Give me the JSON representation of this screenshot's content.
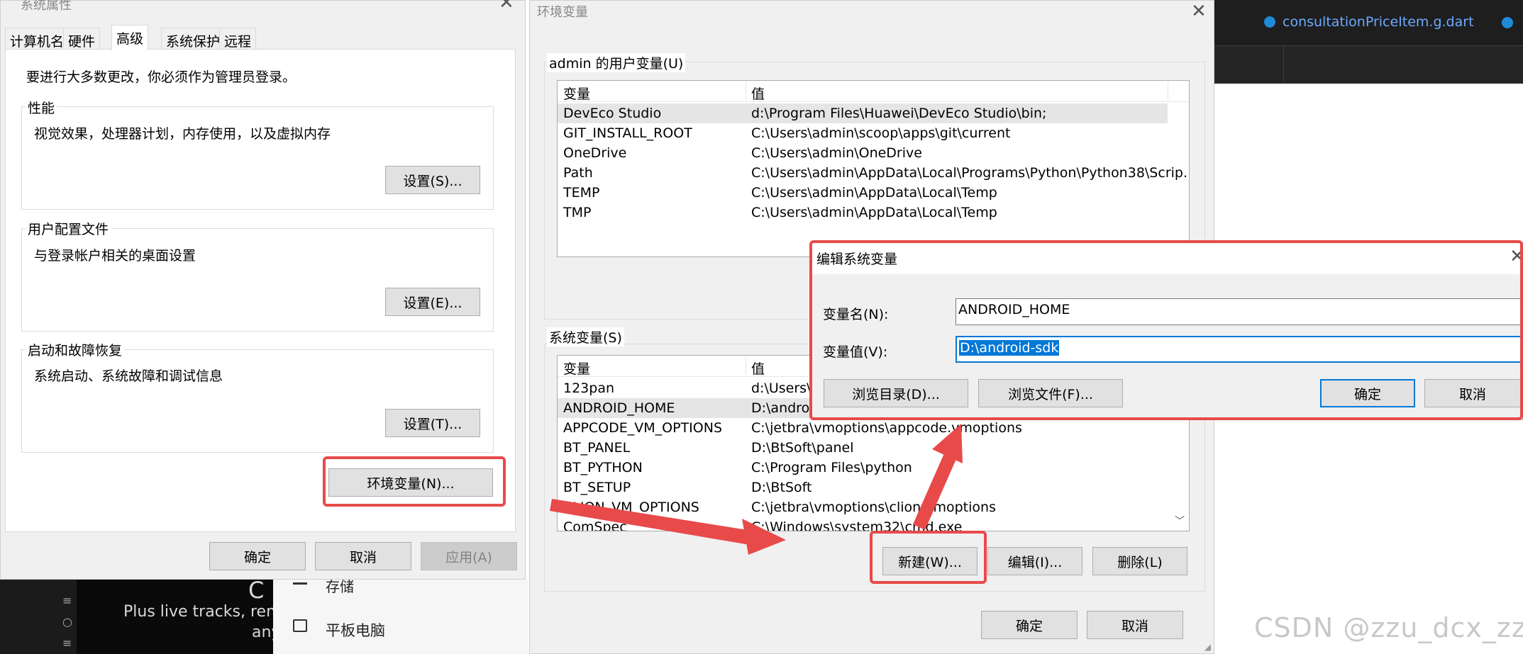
{
  "background": {
    "editor_tab_file": "consultationPriceItem.g.dart",
    "dark_panel": {
      "line1": "Plus live tracks, rem",
      "line2": "any",
      "partial_big": "C"
    },
    "side_menu": {
      "item_partial": "存储",
      "item_tablet": "平板电脑"
    },
    "watermark": "CSDN @zzu_dcx_zzu"
  },
  "system_properties": {
    "title": "系统属性",
    "tabs": [
      "计算机名",
      "硬件",
      "高级",
      "系统保护",
      "远程"
    ],
    "active_tab": "高级",
    "admin_note": "要进行大多数更改，你必须作为管理员登录。",
    "groups": [
      {
        "title": "性能",
        "desc": "视觉效果，处理器计划，内存使用，以及虚拟内存",
        "button": "设置(S)..."
      },
      {
        "title": "用户配置文件",
        "desc": "与登录帐户相关的桌面设置",
        "button": "设置(E)..."
      },
      {
        "title": "启动和故障恢复",
        "desc": "系统启动、系统故障和调试信息",
        "button": "设置(T)..."
      }
    ],
    "env_button": "环境变量(N)...",
    "ok": "确定",
    "cancel": "取消",
    "apply": "应用(A)"
  },
  "env_vars": {
    "title": "环境变量",
    "user_group_title": "admin 的用户变量(U)",
    "col_variable": "变量",
    "col_value": "值",
    "user_rows": [
      {
        "name": "DevEco Studio",
        "value": "d:\\Program Files\\Huawei\\DevEco Studio\\bin;"
      },
      {
        "name": "GIT_INSTALL_ROOT",
        "value": "C:\\Users\\admin\\scoop\\apps\\git\\current"
      },
      {
        "name": "OneDrive",
        "value": "C:\\Users\\admin\\OneDrive"
      },
      {
        "name": "Path",
        "value": "C:\\Users\\admin\\AppData\\Local\\Programs\\Python\\Python38\\Scrip..."
      },
      {
        "name": "TEMP",
        "value": "C:\\Users\\admin\\AppData\\Local\\Temp"
      },
      {
        "name": "TMP",
        "value": "C:\\Users\\admin\\AppData\\Local\\Temp"
      }
    ],
    "system_group_title": "系统变量(S)",
    "system_rows": [
      {
        "name": "123pan",
        "value": "d:\\Users\\a"
      },
      {
        "name": "ANDROID_HOME",
        "value": "D:\\androi"
      },
      {
        "name": "APPCODE_VM_OPTIONS",
        "value": "C:\\jetbra\\vmoptions\\appcode.vmoptions"
      },
      {
        "name": "BT_PANEL",
        "value": "D:\\BtSoft\\panel"
      },
      {
        "name": "BT_PYTHON",
        "value": "C:\\Program Files\\python"
      },
      {
        "name": "BT_SETUP",
        "value": "D:\\BtSoft"
      },
      {
        "name": "CLION_VM_OPTIONS",
        "value": "C:\\jetbra\\vmoptions\\clion.vmoptions"
      },
      {
        "name": "ComSpec",
        "value": "C:\\Windows\\system32\\cmd.exe"
      }
    ],
    "new_button": "新建(W)...",
    "edit_button": "编辑(I)...",
    "delete_button": "删除(L)",
    "ok": "确定",
    "cancel": "取消"
  },
  "edit_dialog": {
    "title": "编辑系统变量",
    "name_label": "变量名(N):",
    "name_value": "ANDROID_HOME",
    "value_label": "变量值(V):",
    "value_value": "D:\\android-sdk",
    "browse_dir": "浏览目录(D)...",
    "browse_file": "浏览文件(F)...",
    "ok": "确定",
    "cancel": "取消"
  },
  "colors": {
    "annotation_red": "#e84a4a",
    "selection_blue": "#0078d7"
  }
}
